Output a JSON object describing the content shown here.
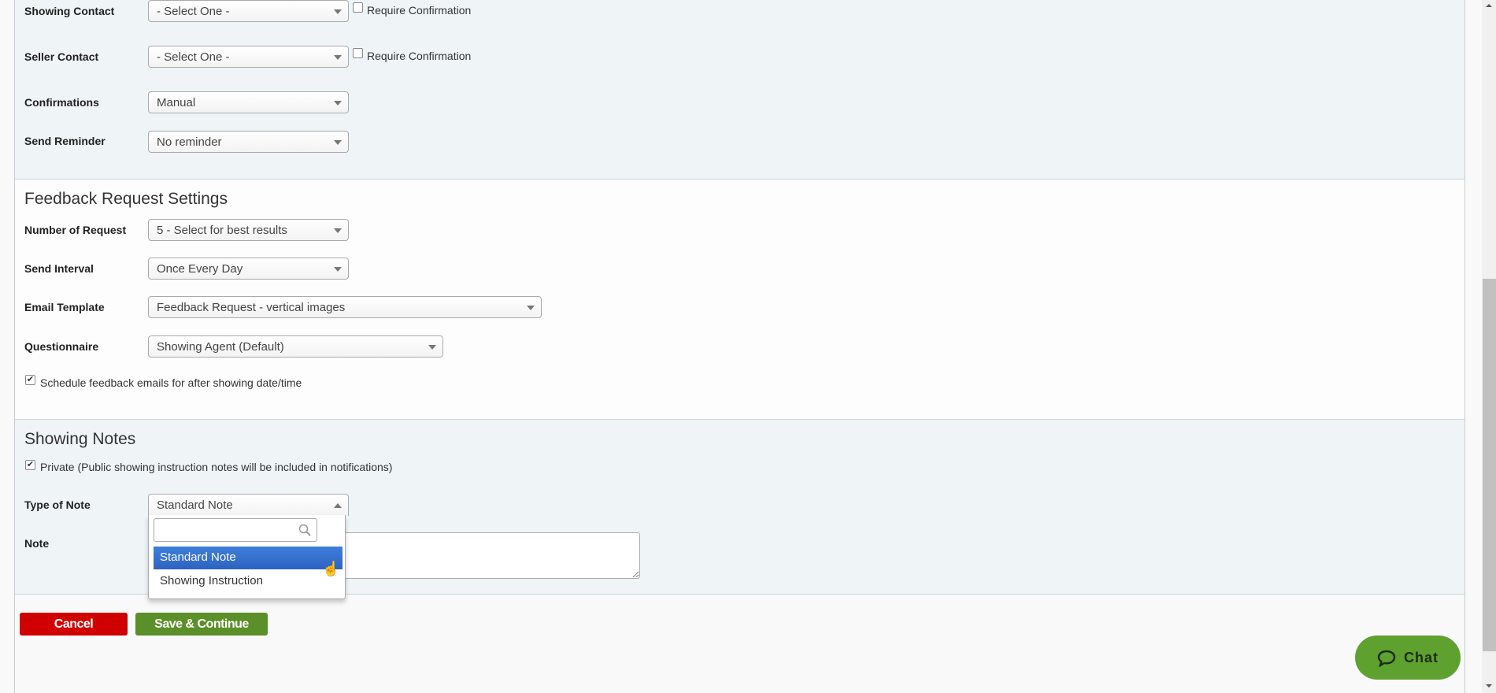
{
  "contacts": {
    "showing_contact": {
      "label": "Showing Contact",
      "value": "- Select One -",
      "confirm_label": "Require Confirmation",
      "confirm_checked": false
    },
    "seller_contact": {
      "label": "Seller Contact",
      "value": "- Select One -",
      "confirm_label": "Require Confirmation",
      "confirm_checked": false
    },
    "confirmations": {
      "label": "Confirmations",
      "value": "Manual"
    },
    "send_reminder": {
      "label": "Send Reminder",
      "value": "No reminder"
    }
  },
  "feedback": {
    "title": "Feedback Request Settings",
    "number_of_request": {
      "label": "Number of Request",
      "value": "5 - Select for best results"
    },
    "send_interval": {
      "label": "Send Interval",
      "value": "Once Every Day"
    },
    "email_template": {
      "label": "Email Template",
      "value": "Feedback Request - vertical images"
    },
    "questionnaire": {
      "label": "Questionnaire",
      "value": "Showing Agent (Default)"
    },
    "schedule": {
      "label": "Schedule feedback emails for after showing date/time",
      "checked": true
    }
  },
  "notes": {
    "title": "Showing Notes",
    "private": {
      "label": "Private (Public showing instruction notes will be included in notifications)",
      "checked": true
    },
    "type_of_note": {
      "label": "Type of Note",
      "value": "Standard Note",
      "search_placeholder": "",
      "options": [
        "Standard Note",
        "Showing Instruction"
      ],
      "highlighted": "Standard Note"
    },
    "note": {
      "label": "Note",
      "value": ""
    }
  },
  "actions": {
    "cancel": "Cancel",
    "save": "Save & Continue"
  },
  "chat": {
    "label": "Chat"
  },
  "colors": {
    "cancel": "#d10000",
    "save": "#5a8f29",
    "chat": "#5ea12f",
    "highlight": "#3a76d6"
  }
}
